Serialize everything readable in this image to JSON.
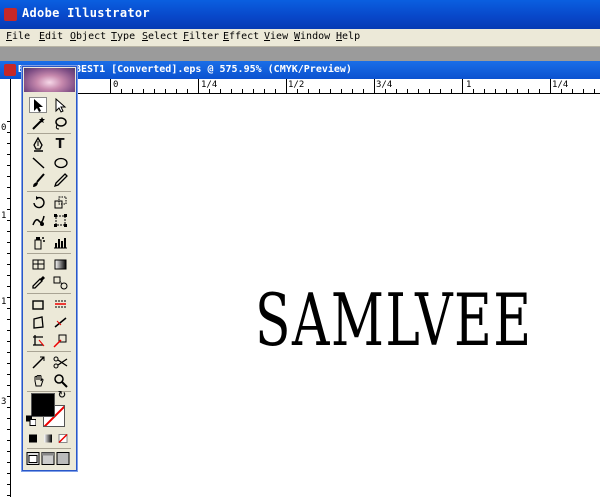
{
  "app": {
    "title": "Adobe Illustrator"
  },
  "menu": [
    "File",
    "Edit",
    "Object",
    "Type",
    "Select",
    "Filter",
    "Effect",
    "View",
    "Window",
    "Help"
  ],
  "document": {
    "prefix": "B",
    "title": "BEST1 [Converted].eps @ 575.95% (CMYK/Preview)"
  },
  "ruler": {
    "marks": [
      "0",
      "1/4",
      "1/2",
      "3/4",
      "1",
      "1/4"
    ],
    "vertical_marks": [
      "0",
      "1",
      "1",
      "3"
    ]
  },
  "canvas": {
    "text": "SAMLVEE"
  },
  "tools": [
    "selection",
    "direct-selection",
    "magic-wand",
    "lasso",
    "pen",
    "type",
    "line",
    "ellipse",
    "paintbrush",
    "pencil",
    "rotate",
    "scale",
    "warp",
    "free-transform",
    "symbol-sprayer",
    "graph",
    "mesh",
    "gradient",
    "eyedropper",
    "blend",
    "slice",
    "scissors-slice",
    "rectangle-2",
    "width",
    "knife",
    "scissors",
    "hand",
    "zoom"
  ]
}
